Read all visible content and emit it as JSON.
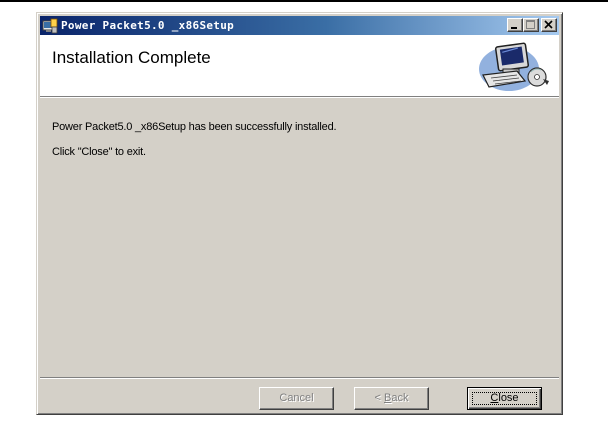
{
  "window": {
    "title": "Power Packet5.0 _x86Setup",
    "controls": {
      "minimize_icon": "minimize-icon",
      "maximize_icon": "maximize-icon",
      "close_icon": "close-icon"
    }
  },
  "header": {
    "title": "Installation Complete",
    "graphic_icon": "computer-install-icon"
  },
  "content": {
    "message": "Power Packet5.0 _x86Setup has been successfully installed.",
    "instruction": "Click \"Close\" to exit."
  },
  "buttons": {
    "cancel": {
      "prefix": "",
      "accel": "",
      "rest": "Cancel",
      "enabled": false
    },
    "back": {
      "prefix": "< ",
      "accel": "B",
      "rest": "ack",
      "enabled": false
    },
    "close": {
      "prefix": "",
      "accel": "C",
      "rest": "lose",
      "enabled": true,
      "default": true
    }
  },
  "colors": {
    "titlebar_start": "#0a246a",
    "titlebar_end": "#a6caf0",
    "face": "#d4d0c8",
    "disabled_text": "#808080"
  }
}
